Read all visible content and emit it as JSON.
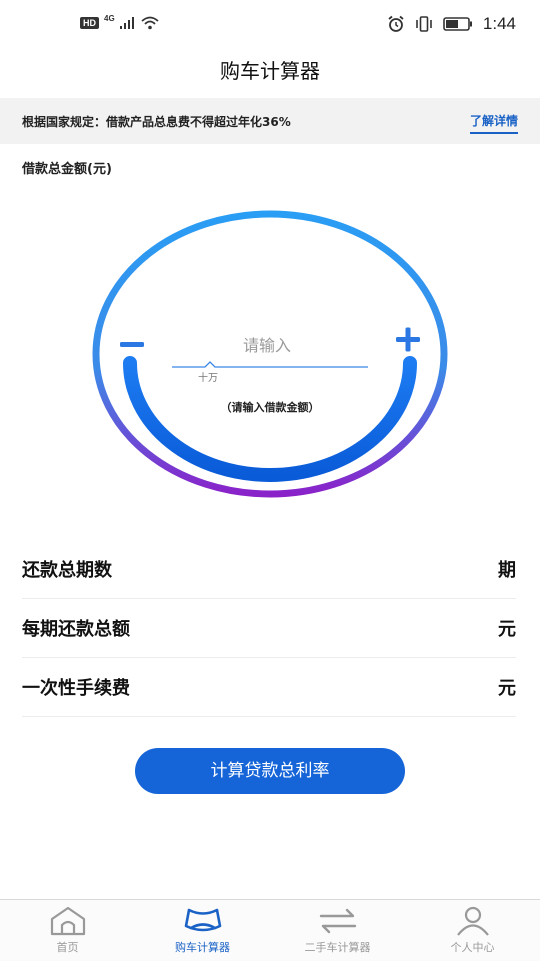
{
  "status_bar": {
    "hd": "HD",
    "network": "4G",
    "time": "1:44"
  },
  "header": {
    "title": "购车计算器"
  },
  "notice": {
    "text": "根据国家规定：借款产品总息费不得超过年化36%",
    "link": "了解详情"
  },
  "amount": {
    "label": "借款总金额(元)",
    "placeholder": "请输入",
    "unit": "十万",
    "hint": "（请输入借款金额）",
    "minus_icon": "minus-icon",
    "plus_icon": "plus-icon"
  },
  "rows": [
    {
      "label": "还款总期数",
      "unit": "期"
    },
    {
      "label": "每期还款总额",
      "unit": "元"
    },
    {
      "label": "一次性手续费",
      "unit": "元"
    }
  ],
  "calc_button": "计算贷款总利率",
  "tabs": [
    {
      "label": "首页",
      "icon": "home-icon",
      "active": false
    },
    {
      "label": "购车计算器",
      "icon": "car-calculator-icon",
      "active": true
    },
    {
      "label": "二手车计算器",
      "icon": "swap-arrows-icon",
      "active": false
    },
    {
      "label": "个人中心",
      "icon": "user-icon",
      "active": false
    }
  ],
  "colors": {
    "accent": "#1565d8",
    "ring_top": "#2a9df4",
    "ring_bottom": "#8a22c9",
    "inactive": "#999999"
  }
}
